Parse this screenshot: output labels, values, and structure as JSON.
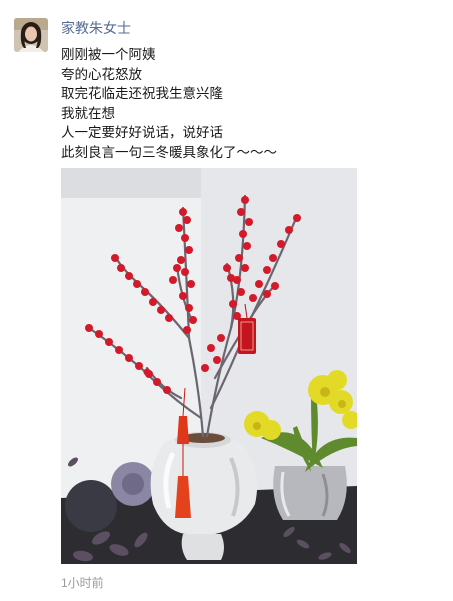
{
  "post": {
    "author_name": "家教朱女士",
    "lines": [
      "刚刚被一个阿姨",
      "夸的心花怒放",
      "取完花临走还祝我生意兴隆",
      "我就在想",
      "人一定要好好说话，说好话",
      "此刻良言一句三冬暖具象化了～～～"
    ],
    "timestamp": "1小时前"
  },
  "colors": {
    "author_link": "#576b95",
    "berry_red": "#d21a2a",
    "timestamp_gray": "#9b9b9b"
  }
}
